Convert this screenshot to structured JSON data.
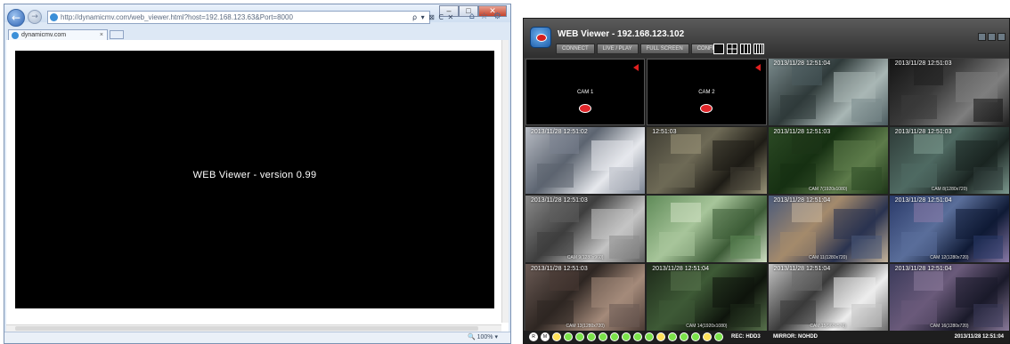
{
  "browser": {
    "address": "http://dynamicmv.com/web_viewer.html?host=192.168.123.63&Port=8000",
    "tab_label": "dynamicmv.com",
    "tab_close": "×",
    "address_tools": "ρ ▾ ⊠ C ✕",
    "zoom": "🔍 100%  ▾",
    "page_message": "WEB Viewer - version 0.99",
    "icons": [
      "back-icon",
      "forward-icon",
      "home-icon",
      "star-icon",
      "gear-icon"
    ]
  },
  "viewer": {
    "title": "WEB Viewer - 192.168.123.102",
    "buttons": [
      "CONNECT",
      "LIVE / PLAY",
      "FULL SCREEN",
      "CONFIG"
    ],
    "layouts": [
      "1x1",
      "2x2",
      "3x3",
      "4x4"
    ],
    "cameras": [
      {
        "label": "CAM 1",
        "timestamp": "",
        "empty": true,
        "colors": [
          "#000000"
        ]
      },
      {
        "label": "CAM 2",
        "timestamp": "",
        "empty": true,
        "colors": [
          "#000000"
        ]
      },
      {
        "label": "",
        "timestamp": "2013/11/28  12:51:04",
        "empty": false,
        "colors": [
          "#7a8a8c",
          "#2f3a3a",
          "#a9b7b5",
          "#4b5b5f"
        ]
      },
      {
        "label": "",
        "timestamp": "2013/11/28  12:51:03",
        "empty": false,
        "colors": [
          "#141414",
          "#3a3a3a",
          "#7e7e7e",
          "#1f1f1f"
        ]
      },
      {
        "label": "",
        "timestamp": "2013/11/28  12:51:02",
        "empty": false,
        "colors": [
          "#b8bcc4",
          "#5c6470",
          "#e6e8ec",
          "#7a8290"
        ]
      },
      {
        "label": "",
        "timestamp": "12:51:03",
        "empty": false,
        "colors": [
          "#3f3d33",
          "#6e6a56",
          "#1e1c16",
          "#9a9478"
        ]
      },
      {
        "label": "CAM 7(1920x1080)",
        "timestamp": "2013/11/28  12:51:03",
        "empty": false,
        "colors": [
          "#2c4a25",
          "#163012",
          "#5d7b4a",
          "#1e3518"
        ]
      },
      {
        "label": "CAM 8(1280x720)",
        "timestamp": "2013/11/28  12:51:03",
        "empty": false,
        "colors": [
          "#2e3b38",
          "#4f6a62",
          "#1a2421",
          "#7d9a90"
        ]
      },
      {
        "label": "CAM 9(1280x960)",
        "timestamp": "2013/11/28  12:51:03",
        "empty": false,
        "colors": [
          "#8a8a8a",
          "#3e3e3e",
          "#c4c4c4",
          "#5e5e5e"
        ]
      },
      {
        "label": "",
        "timestamp": "",
        "empty": false,
        "colors": [
          "#5f8a58",
          "#a7c59a",
          "#3d5c37",
          "#cfe0c3"
        ]
      },
      {
        "label": "CAM 11(1280x720)",
        "timestamp": "2013/11/28  12:51:04",
        "empty": false,
        "colors": [
          "#4a5a7a",
          "#a48a6c",
          "#2a3350",
          "#c6b59c"
        ]
      },
      {
        "label": "CAM 12(1280x720)",
        "timestamp": "2013/11/28  12:51:04",
        "empty": false,
        "colors": [
          "#2a3a6a",
          "#5a6e9a",
          "#0f1a35",
          "#8a7aa8"
        ]
      },
      {
        "label": "CAM 13(1280x720)",
        "timestamp": "2013/11/28  12:51:03",
        "empty": false,
        "colors": [
          "#6a5a54",
          "#2e2622",
          "#a48a7a",
          "#4a3a34"
        ]
      },
      {
        "label": "CAM 14(1920x1080)",
        "timestamp": "2013/11/28  12:51:04",
        "empty": false,
        "colors": [
          "#1e2a1a",
          "#3e5a36",
          "#0e140c",
          "#58724c"
        ]
      },
      {
        "label": "CAM 15(960x576)",
        "timestamp": "2013/11/28  12:51:04",
        "empty": false,
        "colors": [
          "#c4c4c4",
          "#3a3a3a",
          "#ededed",
          "#6c6c6c"
        ]
      },
      {
        "label": "CAM 16(1280x720)",
        "timestamp": "2013/11/28  12:51:04",
        "empty": false,
        "colors": [
          "#3a3a5a",
          "#6a5a7a",
          "#1a1a2a",
          "#8a7a9a"
        ]
      }
    ],
    "status_dots": [
      {
        "text": "R",
        "color": "#ffffff"
      },
      {
        "text": "M",
        "color": "#ffffff"
      },
      {
        "text": "",
        "color": "#ffe15a"
      },
      {
        "text": "",
        "color": "#7be24a"
      },
      {
        "text": "",
        "color": "#7be24a"
      },
      {
        "text": "",
        "color": "#7be24a"
      },
      {
        "text": "",
        "color": "#7be24a"
      },
      {
        "text": "",
        "color": "#7be24a"
      },
      {
        "text": "",
        "color": "#7be24a"
      },
      {
        "text": "",
        "color": "#7be24a"
      },
      {
        "text": "",
        "color": "#7be24a"
      },
      {
        "text": "",
        "color": "#ffe15a"
      },
      {
        "text": "",
        "color": "#7be24a"
      },
      {
        "text": "",
        "color": "#7be24a"
      },
      {
        "text": "",
        "color": "#7be24a"
      },
      {
        "text": "",
        "color": "#ffe15a"
      },
      {
        "text": "",
        "color": "#7be24a"
      }
    ],
    "rec_status": "REC: HDD3",
    "mirror_status": "MIRROR: NOHDD",
    "clock": "2013/11/28 12:51:04"
  }
}
